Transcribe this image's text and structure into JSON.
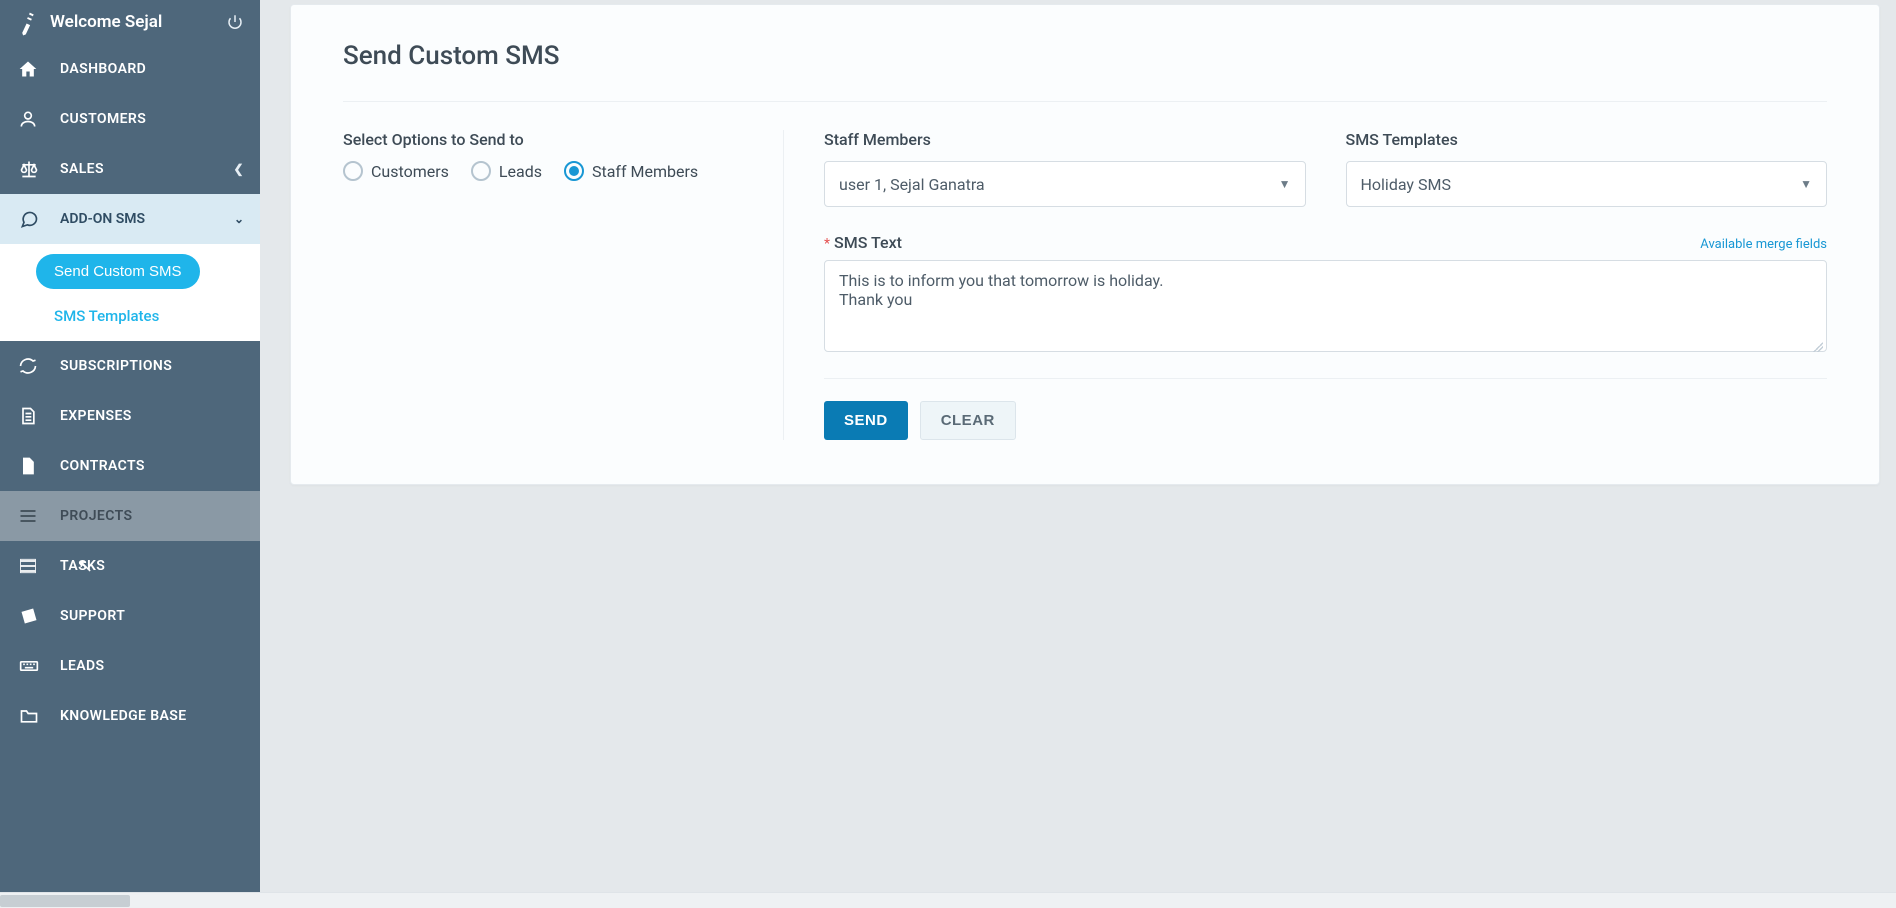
{
  "welcome": {
    "text": "Welcome Sejal"
  },
  "sidebar": {
    "items": [
      {
        "label": "DASHBOARD",
        "icon": "home"
      },
      {
        "label": "CUSTOMERS",
        "icon": "user"
      },
      {
        "label": "SALES",
        "icon": "scale",
        "chevron": "right"
      },
      {
        "label": "ADD-ON SMS",
        "icon": "chat",
        "chevron": "down",
        "expanded": true,
        "children": {
          "active_pill": "Send Custom SMS",
          "link": "SMS Templates"
        }
      },
      {
        "label": "SUBSCRIPTIONS",
        "icon": "refresh"
      },
      {
        "label": "EXPENSES",
        "icon": "doc"
      },
      {
        "label": "CONTRACTS",
        "icon": "file"
      },
      {
        "label": "PROJECTS",
        "icon": "bars",
        "hover": true
      },
      {
        "label": "TASKS",
        "icon": "list"
      },
      {
        "label": "SUPPORT",
        "icon": "ticket"
      },
      {
        "label": "LEADS",
        "icon": "keyboard"
      },
      {
        "label": "KNOWLEDGE BASE",
        "icon": "folder"
      }
    ]
  },
  "page": {
    "title": "Send Custom SMS",
    "opt_label": "Select Options to Send to",
    "opts": [
      "Customers",
      "Leads",
      "Staff Members"
    ],
    "opt_selected": 2,
    "staff_label": "Staff Members",
    "staff_value": "user 1, Sejal Ganatra",
    "template_label": "SMS Templates",
    "template_value": "Holiday SMS",
    "sms_label": "SMS Text",
    "merge_link": "Available merge fields",
    "sms_value": "This is to inform you that tomorrow is holiday.\nThank you",
    "send": "SEND",
    "clear": "CLEAR"
  }
}
